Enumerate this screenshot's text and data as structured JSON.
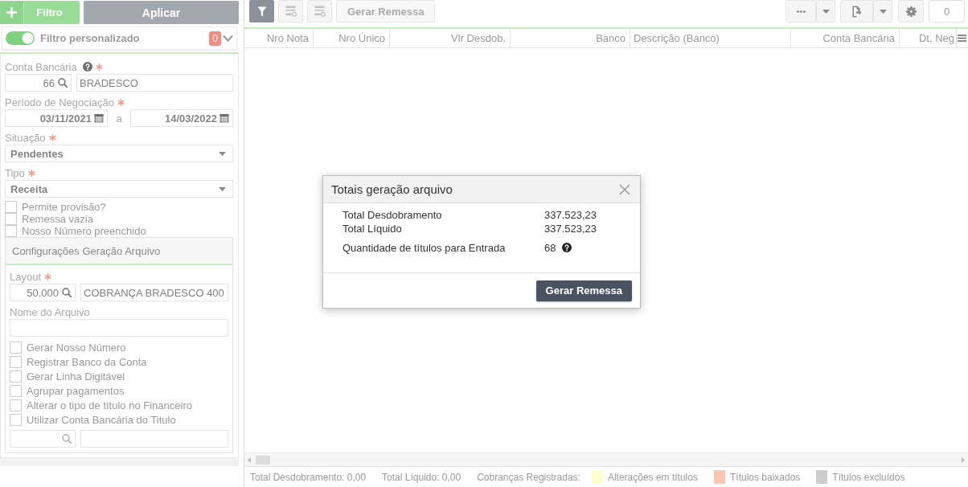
{
  "filter_bar": {
    "add_button": "Filtro",
    "apply_button": "Aplicar"
  },
  "custom_filter": {
    "on": true,
    "label": "Filtro personalizado",
    "count": "0",
    "expanded": false
  },
  "form": {
    "items": [
      {
        "kind": "lookup",
        "label": "Conta Bancária",
        "help": true,
        "required": true,
        "code": "66",
        "description": "BRADESCO"
      },
      {
        "kind": "date_range",
        "label": "Período de Negociação",
        "required": true,
        "from": "03/11/2021",
        "separator": "a",
        "to": "14/03/2022"
      },
      {
        "kind": "select",
        "label": "Situação",
        "required": true,
        "value": "Pendentes"
      },
      {
        "kind": "select",
        "label": "Tipo",
        "required": true,
        "value": "Receita"
      },
      {
        "kind": "checkbox",
        "label": "Permite provisão?",
        "checked": false
      },
      {
        "kind": "checkbox",
        "label": "Remessa vazia",
        "checked": false
      },
      {
        "kind": "checkbox",
        "label": "Nosso Número preenchido",
        "checked": false
      },
      {
        "kind": "section",
        "title": "Configurações Geração Arquivo",
        "items": [
          {
            "kind": "lookup",
            "label": "Layout",
            "help": false,
            "required": true,
            "code": "50.000",
            "description": "COBRANÇA BRADESCO 400"
          },
          {
            "kind": "text",
            "label": "Nome do Arquivo",
            "required": false
          },
          {
            "kind": "checkbox",
            "label": "Gerar Nosso Número",
            "checked": false
          },
          {
            "kind": "checkbox",
            "label": "Registrar Banco da Conta",
            "checked": false
          },
          {
            "kind": "checkbox",
            "label": "Gerar Linha Digitável",
            "checked": false
          },
          {
            "kind": "checkbox",
            "label": "Agrupar pagamentos",
            "checked": false
          },
          {
            "kind": "checkbox",
            "label": "Alterar o tipo de título no Financeiro",
            "checked": false
          },
          {
            "kind": "checkbox",
            "label": "Utilizar Conta Bancária do Titulo",
            "checked": false
          },
          {
            "kind": "lookup"
          }
        ]
      }
    ]
  },
  "toolbar": {
    "left": [
      {
        "kind": "filter",
        "selected": true,
        "disabled": false
      },
      {
        "kind": "rows",
        "selected": false,
        "disabled": true
      },
      {
        "kind": "rows",
        "selected": false,
        "disabled": true
      },
      {
        "kind": "text",
        "label": "Gerar Remessa",
        "selected": false,
        "disabled": true
      }
    ],
    "right": [
      {
        "kind": "more"
      },
      {
        "kind": "dropdown"
      },
      {
        "kind": "export"
      },
      {
        "kind": "dropdown"
      },
      {
        "kind": "settings"
      }
    ],
    "counter": "0"
  },
  "table": {
    "columns": [
      {
        "label": "Nro Nota",
        "kind": "number"
      },
      {
        "label": "Nro Único",
        "kind": "number"
      },
      {
        "label": "Vlr Desdob.",
        "kind": "number"
      },
      {
        "label": "Banco",
        "kind": "number"
      },
      {
        "label": "Descrição (Banco)",
        "kind": "text"
      },
      {
        "label": "Conta Bancária",
        "kind": "number"
      },
      {
        "label": "Dt. Neg",
        "kind": "date"
      }
    ]
  },
  "footer": {
    "totals": [
      "Total Desdobramento: 0,00",
      "Total Líquido: 0,00"
    ],
    "legend": {
      "title": "Cobranças Registradas:",
      "items": [
        {
          "label": "Alterações em títulos",
          "color": "#ffffcc"
        },
        {
          "label": "Títulos baixados",
          "color": "#fcc7b0"
        },
        {
          "label": "Títulos excluídos",
          "color": "#cccccc"
        }
      ]
    }
  },
  "dialog": {
    "title": "Totais geração arquivo",
    "rows": [
      {
        "label": "Total Desdobramento",
        "value": "337.523,23",
        "help": false
      },
      {
        "label": "Total Líquido",
        "value": "337.523,23",
        "help": false
      },
      {
        "label": "Quantidade de títulos para Entrada",
        "value": "68",
        "help": true
      }
    ],
    "button": "Gerar Remessa"
  }
}
